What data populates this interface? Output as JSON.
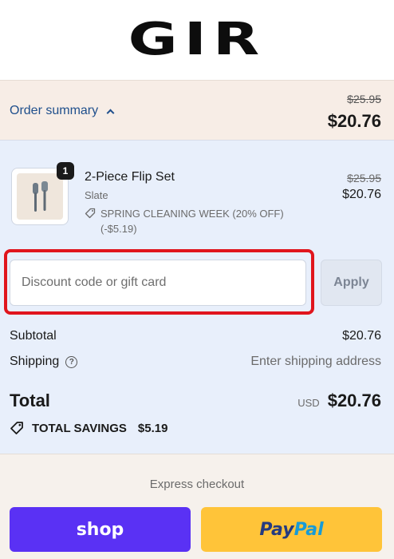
{
  "header": {
    "logo_text": "GIR"
  },
  "summary": {
    "toggle_label": "Order summary",
    "original_total": "$25.95",
    "discounted_total": "$20.76"
  },
  "line_item": {
    "quantity": "1",
    "title": "2-Piece Flip Set",
    "variant": "Slate",
    "discount_text": "SPRING CLEANING WEEK (20% OFF) (-$5.19)",
    "original_price": "$25.95",
    "price": "$20.76"
  },
  "discount": {
    "placeholder": "Discount code or gift card",
    "apply_label": "Apply"
  },
  "totals": {
    "subtotal_label": "Subtotal",
    "subtotal_value": "$20.76",
    "shipping_label": "Shipping",
    "shipping_value": "Enter shipping address",
    "total_label": "Total",
    "currency": "USD",
    "total_value": "$20.76",
    "savings_label": "TOTAL SAVINGS",
    "savings_value": "$5.19"
  },
  "express": {
    "label": "Express checkout",
    "shop_label": "shop",
    "paypal_part1": "Pay",
    "paypal_part2": "Pal"
  },
  "colors": {
    "link_blue": "#1f4f8c",
    "highlight_red": "#e0151d",
    "shop_purple": "#5a31f4",
    "paypal_yellow": "#ffc439"
  },
  "icons": [
    "chevron-up-icon",
    "discount-tag-icon",
    "help-circle-icon",
    "savings-tag-icon"
  ]
}
